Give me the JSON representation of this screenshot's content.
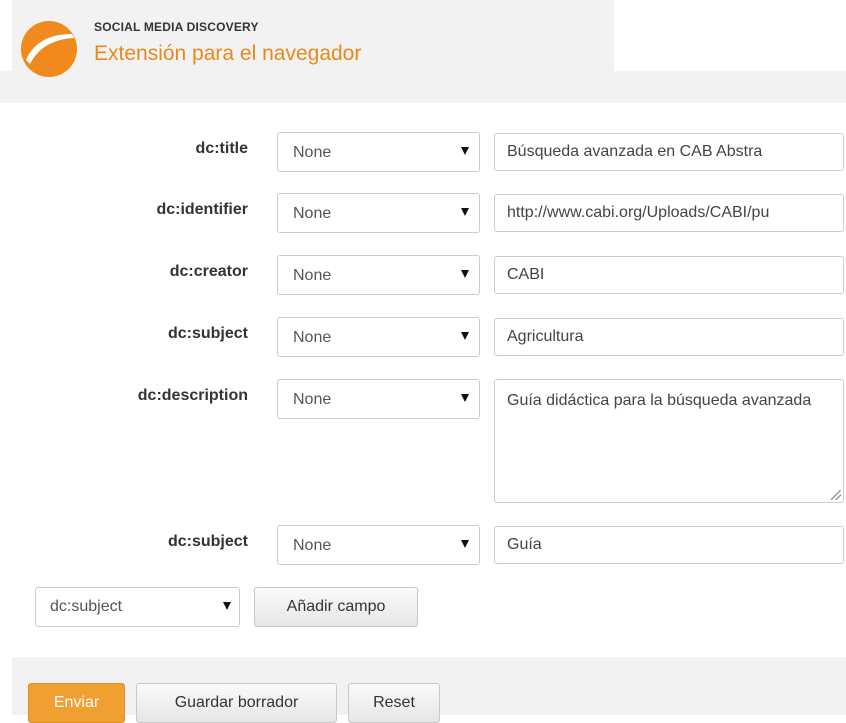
{
  "header": {
    "brand_top": "SOCIAL MEDIA DISCOVERY",
    "brand_main": "Extensión para el navegador",
    "accent_color": "#e8891c",
    "logo_icon": "orange-circle-logo"
  },
  "fields": [
    {
      "label": "dc:title",
      "select": "None",
      "value": "Búsqueda avanzada en CAB Abstra"
    },
    {
      "label": "dc:identifier",
      "select": "None",
      "value": "http://www.cabi.org/Uploads/CABI/pu"
    },
    {
      "label": "dc:creator",
      "select": "None",
      "value": "CABI"
    },
    {
      "label": "dc:subject",
      "select": "None",
      "value": "Agricultura"
    },
    {
      "label": "dc:description",
      "select": "None",
      "value": "Guía didáctica para la búsqueda avanzada"
    },
    {
      "label": "dc:subject",
      "select": "None",
      "value": "Guía"
    }
  ],
  "add_field": {
    "select": "dc:subject",
    "button": "Añadir campo"
  },
  "actions": {
    "submit": "Enviar",
    "draft": "Guardar borrador",
    "reset": "Reset",
    "submit_color": "#f0a030"
  }
}
